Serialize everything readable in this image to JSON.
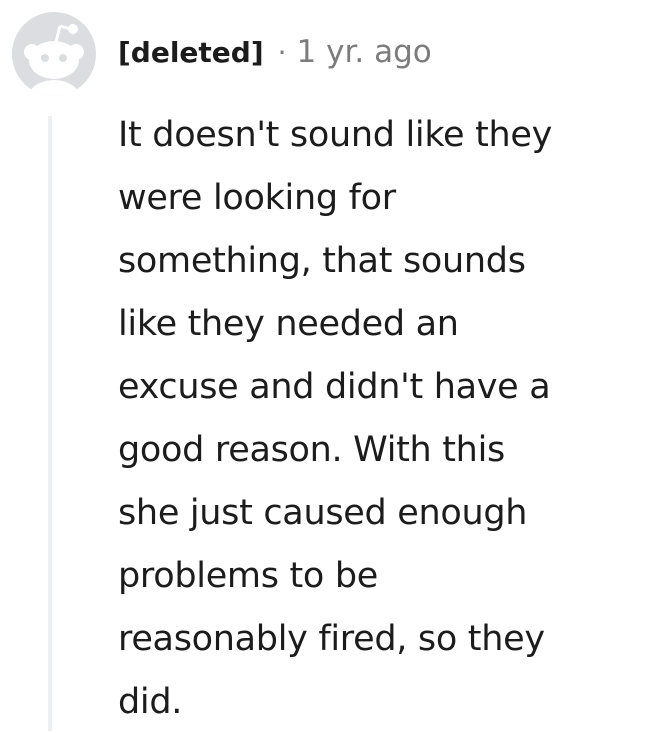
{
  "comment": {
    "avatar_icon": "snoo-avatar-icon",
    "author": "[deleted]",
    "separator": "·",
    "timestamp": "1 yr. ago",
    "body_lines": [
      "It doesn't sound like they",
      "were looking for",
      "something, that sounds",
      "like they needed an",
      "excuse and didn't have a",
      "good reason. With this",
      "she just caused enough",
      "problems to be",
      "reasonably fired, so they",
      "did."
    ]
  },
  "colors": {
    "avatar_bg": "#dbdde0",
    "avatar_fg": "#ffffff",
    "text": "#1c1c1c",
    "meta": "#7c7c7c",
    "thread_line": "#edeff1"
  }
}
